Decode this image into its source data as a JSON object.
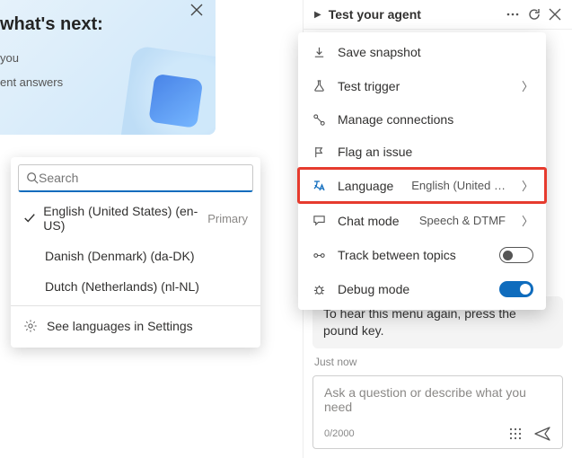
{
  "hero": {
    "title": "what's next:",
    "line1": "you",
    "line2": "ent answers"
  },
  "langPopup": {
    "searchPlaceholder": "Search",
    "items": [
      {
        "label": "English (United States) (en-US)",
        "selected": true,
        "primary": "Primary"
      },
      {
        "label": "Danish (Denmark) (da-DK)",
        "selected": false
      },
      {
        "label": "Dutch (Netherlands) (nl-NL)",
        "selected": false
      }
    ],
    "settingsLabel": "See languages in Settings"
  },
  "testPanel": {
    "title": "Test your agent",
    "menu": {
      "saveSnapshot": "Save snapshot",
      "testTrigger": "Test trigger",
      "manageConnections": "Manage connections",
      "flagIssue": "Flag an issue",
      "languageLabel": "Language",
      "languageValue": "English (United …",
      "chatModeLabel": "Chat mode",
      "chatModeValue": "Speech & DTMF",
      "trackTopics": "Track between topics",
      "debugMode": "Debug mode"
    },
    "chat": {
      "lastBotMessage": "To hear this menu again, press the pound key.",
      "timestamp": "Just now",
      "inputPlaceholder": "Ask a question or describe what you need",
      "counter": "0/2000"
    }
  }
}
